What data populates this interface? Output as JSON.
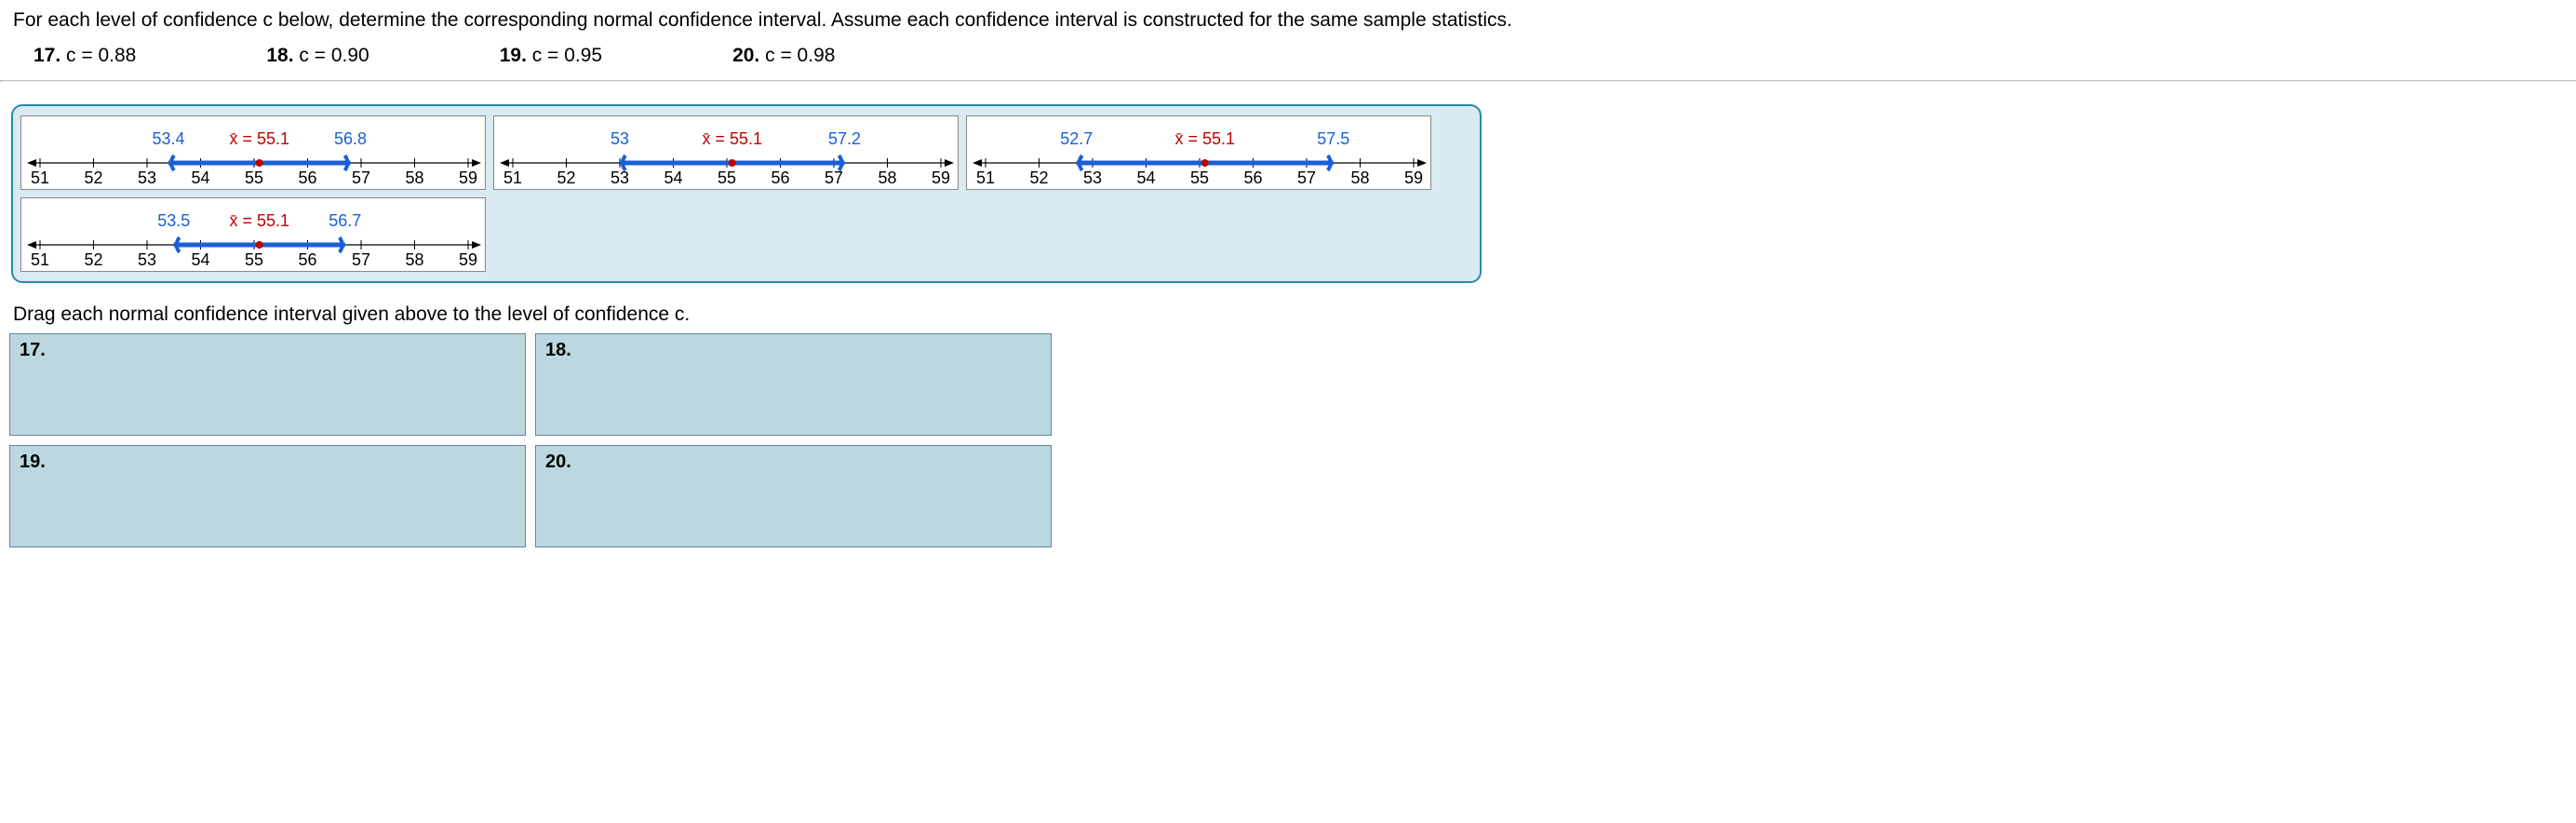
{
  "question": "For each level of confidence c below, determine the corresponding normal confidence interval. Assume each confidence interval is constructed for the same sample statistics.",
  "options": [
    {
      "num": "17.",
      "text": "c = 0.88"
    },
    {
      "num": "18.",
      "text": "c = 0.90"
    },
    {
      "num": "19.",
      "text": "c = 0.95"
    },
    {
      "num": "20.",
      "text": "c = 0.98"
    }
  ],
  "numberlines": [
    {
      "id": "nl-a",
      "min": 51,
      "max": 59,
      "left": 53.4,
      "right": 56.8,
      "left_label": "53.4",
      "right_label": "56.8",
      "center_label": "x̄ = 55.1",
      "center": 55.1,
      "ticks": [
        "51",
        "52",
        "53",
        "54",
        "55",
        "56",
        "57",
        "58",
        "59"
      ]
    },
    {
      "id": "nl-b",
      "min": 51,
      "max": 59,
      "left": 53.0,
      "right": 57.2,
      "left_label": "53",
      "right_label": "57.2",
      "center_label": "x̄ = 55.1",
      "center": 55.1,
      "ticks": [
        "51",
        "52",
        "53",
        "54",
        "55",
        "56",
        "57",
        "58",
        "59"
      ]
    },
    {
      "id": "nl-c",
      "min": 51,
      "max": 59,
      "left": 52.7,
      "right": 57.5,
      "left_label": "52.7",
      "right_label": "57.5",
      "center_label": "x̄ = 55.1",
      "center": 55.1,
      "ticks": [
        "51",
        "52",
        "53",
        "54",
        "55",
        "56",
        "57",
        "58",
        "59"
      ]
    },
    {
      "id": "nl-d",
      "min": 51,
      "max": 59,
      "left": 53.5,
      "right": 56.7,
      "left_label": "53.5",
      "right_label": "56.7",
      "center_label": "x̄ = 55.1",
      "center": 55.1,
      "ticks": [
        "51",
        "52",
        "53",
        "54",
        "55",
        "56",
        "57",
        "58",
        "59"
      ]
    }
  ],
  "instruction": "Drag each normal confidence interval given above to the level of confidence c.",
  "targets": [
    "17.",
    "18.",
    "19.",
    "20."
  ],
  "chart_data": [
    {
      "type": "numberline",
      "range": [
        51,
        59
      ],
      "interval": [
        53.4,
        56.8
      ],
      "center": 55.1,
      "center_label": "x̄ = 55.1"
    },
    {
      "type": "numberline",
      "range": [
        51,
        59
      ],
      "interval": [
        53.0,
        57.2
      ],
      "center": 55.1,
      "center_label": "x̄ = 55.1"
    },
    {
      "type": "numberline",
      "range": [
        51,
        59
      ],
      "interval": [
        52.7,
        57.5
      ],
      "center": 55.1,
      "center_label": "x̄ = 55.1"
    },
    {
      "type": "numberline",
      "range": [
        51,
        59
      ],
      "interval": [
        53.5,
        56.7
      ],
      "center": 55.1,
      "center_label": "x̄ = 55.1"
    }
  ]
}
